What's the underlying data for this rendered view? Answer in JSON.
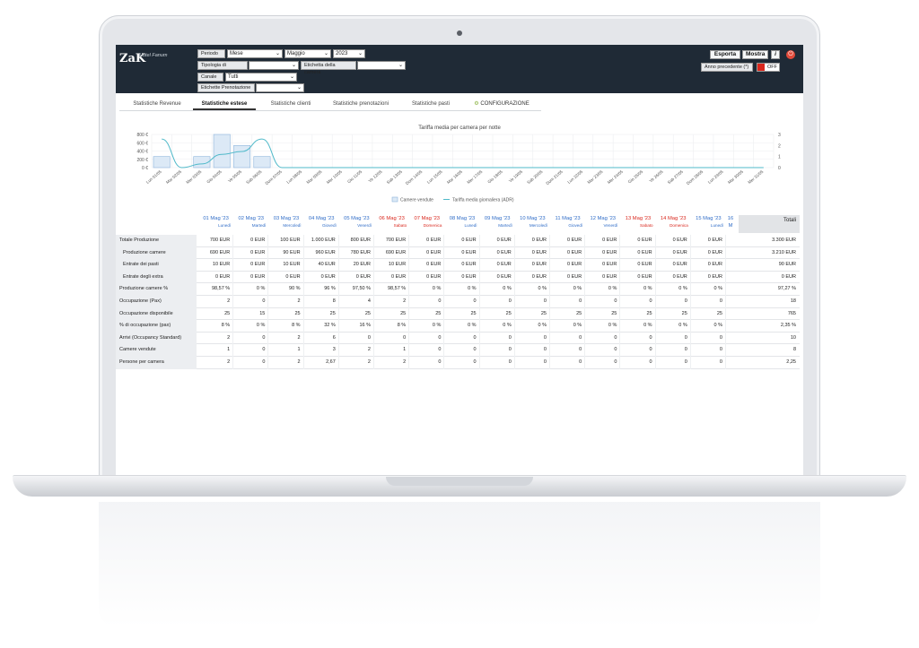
{
  "app": {
    "logo": "ZaK",
    "hotel": "Hotel Fanum"
  },
  "filters": {
    "periodo_label": "Periodo",
    "periodo_value": "Mese",
    "mese_value": "Maggio",
    "anno_value": "2023",
    "tipologia_label": "Tipologia di Camera",
    "tipologia_value": "",
    "etichetta_camera_label": "Etichetta della camera",
    "etichetta_camera_value": "",
    "canale_label": "Canale",
    "canale_value": "Tutti",
    "etichette_pren_label": "Etichette Prenotazione",
    "etichette_pren_value": ""
  },
  "actions": {
    "esporta": "Esporta",
    "mostra": "Mostra",
    "info": "i",
    "anno_precedente": "Anno precedente (*)",
    "toggle": "OFF"
  },
  "tabs": [
    {
      "label": "Statistiche Revenue"
    },
    {
      "label": "Statistiche estese"
    },
    {
      "label": "Statistiche clienti"
    },
    {
      "label": "Statistiche prenotazioni"
    },
    {
      "label": "Statistiche pasti"
    },
    {
      "label": "CONFIGURAZIONE"
    }
  ],
  "chart_data": {
    "type": "bar",
    "title": "Tariffa media per camera per notte",
    "categories": [
      "Lun 01/05",
      "Mar 02/05",
      "Mer 03/05",
      "Gio 04/05",
      "Ve 05/05",
      "Sab 06/05",
      "Dom 07/05",
      "Lun 08/05",
      "Mar 09/05",
      "Mer 10/05",
      "Gio 11/05",
      "Ve 12/05",
      "Sab 13/05",
      "Dom 14/05",
      "Lun 15/05",
      "Mar 16/05",
      "Mer 17/05",
      "Gio 18/05",
      "Ve 19/05",
      "Sab 20/05",
      "Dom 21/05",
      "Lun 22/05",
      "Mar 23/05",
      "Mer 24/05",
      "Gio 25/05",
      "Ve 26/05",
      "Sab 27/05",
      "Dom 28/05",
      "Lun 29/05",
      "Mar 30/05",
      "Mer 31/05"
    ],
    "series": [
      {
        "name": "Camere vendute",
        "type": "bar",
        "axis": "right",
        "values": [
          1,
          0,
          1,
          3,
          2,
          1,
          0,
          0,
          0,
          0,
          0,
          0,
          0,
          0,
          0,
          0,
          0,
          0,
          0,
          0,
          0,
          0,
          0,
          0,
          0,
          0,
          0,
          0,
          0,
          0,
          0
        ]
      },
      {
        "name": "Tariffa media giornaliera (ADR)",
        "type": "line",
        "axis": "left",
        "values": [
          690,
          0,
          90,
          320,
          390,
          690,
          0,
          0,
          0,
          0,
          0,
          0,
          0,
          0,
          0,
          0,
          0,
          0,
          0,
          0,
          0,
          0,
          0,
          0,
          0,
          0,
          0,
          0,
          0,
          0,
          0
        ]
      }
    ],
    "y_left": {
      "ticks": [
        "0 €",
        "200 €",
        "400 €",
        "600 €",
        "800 €"
      ],
      "ylim": [
        0,
        800
      ]
    },
    "y_right": {
      "ticks": [
        "0",
        "1",
        "2",
        "3"
      ],
      "ylim": [
        0,
        3
      ]
    },
    "legend": "bottom",
    "grid": true
  },
  "table": {
    "totals_label": "Totali",
    "days": [
      {
        "date": "01 Mag '23",
        "weekday": "Lunedì",
        "red": false
      },
      {
        "date": "02 Mag '23",
        "weekday": "Martedì",
        "red": false
      },
      {
        "date": "03 Mag '23",
        "weekday": "Mercoledì",
        "red": false
      },
      {
        "date": "04 Mag '23",
        "weekday": "Giovedì",
        "red": false
      },
      {
        "date": "05 Mag '23",
        "weekday": "Venerdì",
        "red": false
      },
      {
        "date": "06 Mag '23",
        "weekday": "Sabato",
        "red": true
      },
      {
        "date": "07 Mag '23",
        "weekday": "Domenica",
        "red": true
      },
      {
        "date": "08 Mag '23",
        "weekday": "Lunedì",
        "red": false
      },
      {
        "date": "09 Mag '23",
        "weekday": "Martedì",
        "red": false
      },
      {
        "date": "10 Mag '23",
        "weekday": "Mercoledì",
        "red": false
      },
      {
        "date": "11 Mag '23",
        "weekday": "Giovedì",
        "red": false
      },
      {
        "date": "12 Mag '23",
        "weekday": "Venerdì",
        "red": false
      },
      {
        "date": "13 Mag '23",
        "weekday": "Sabato",
        "red": true
      },
      {
        "date": "14 Mag '23",
        "weekday": "Domenica",
        "red": true
      },
      {
        "date": "15 Mag '23",
        "weekday": "Lunedì",
        "red": false
      },
      {
        "date": "16 M",
        "weekday": "",
        "red": false
      }
    ],
    "rows": [
      {
        "label": "Totale Produzione",
        "sub": false,
        "values": [
          "700 EUR",
          "0 EUR",
          "100 EUR",
          "1.000 EUR",
          "800 EUR",
          "700 EUR",
          "0 EUR",
          "0 EUR",
          "0 EUR",
          "0 EUR",
          "0 EUR",
          "0 EUR",
          "0 EUR",
          "0 EUR",
          "0 EUR"
        ],
        "total": "3.300 EUR"
      },
      {
        "label": "Produzione camere",
        "sub": true,
        "values": [
          "690 EUR",
          "0 EUR",
          "90 EUR",
          "960 EUR",
          "780 EUR",
          "690 EUR",
          "0 EUR",
          "0 EUR",
          "0 EUR",
          "0 EUR",
          "0 EUR",
          "0 EUR",
          "0 EUR",
          "0 EUR",
          "0 EUR"
        ],
        "total": "3.210 EUR"
      },
      {
        "label": "Entrate dei pasti",
        "sub": true,
        "values": [
          "10 EUR",
          "0 EUR",
          "10 EUR",
          "40 EUR",
          "20 EUR",
          "10 EUR",
          "0 EUR",
          "0 EUR",
          "0 EUR",
          "0 EUR",
          "0 EUR",
          "0 EUR",
          "0 EUR",
          "0 EUR",
          "0 EUR"
        ],
        "total": "90 EUR"
      },
      {
        "label": "Entrate degli extra",
        "sub": true,
        "values": [
          "0 EUR",
          "0 EUR",
          "0 EUR",
          "0 EUR",
          "0 EUR",
          "0 EUR",
          "0 EUR",
          "0 EUR",
          "0 EUR",
          "0 EUR",
          "0 EUR",
          "0 EUR",
          "0 EUR",
          "0 EUR",
          "0 EUR"
        ],
        "total": "0 EUR"
      },
      {
        "label": "Produzione camere %",
        "sub": false,
        "values": [
          "98,57 %",
          "0 %",
          "90 %",
          "96 %",
          "97,50 %",
          "98,57 %",
          "0 %",
          "0 %",
          "0 %",
          "0 %",
          "0 %",
          "0 %",
          "0 %",
          "0 %",
          "0 %"
        ],
        "total": "97,27 %"
      },
      {
        "label": "Occupazione (Pax)",
        "sub": false,
        "values": [
          "2",
          "0",
          "2",
          "8",
          "4",
          "2",
          "0",
          "0",
          "0",
          "0",
          "0",
          "0",
          "0",
          "0",
          "0"
        ],
        "total": "18"
      },
      {
        "label": "Occupazione disponibile",
        "sub": false,
        "values": [
          "25",
          "15",
          "25",
          "25",
          "25",
          "25",
          "25",
          "25",
          "25",
          "25",
          "25",
          "25",
          "25",
          "25",
          "25"
        ],
        "total": "765"
      },
      {
        "label": "% di occupazione (pax)",
        "sub": false,
        "values": [
          "8 %",
          "0 %",
          "8 %",
          "32 %",
          "16 %",
          "8 %",
          "0 %",
          "0 %",
          "0 %",
          "0 %",
          "0 %",
          "0 %",
          "0 %",
          "0 %",
          "0 %"
        ],
        "total": "2,35 %"
      },
      {
        "label": "Arrivi (Occupancy Standard)",
        "sub": false,
        "values": [
          "2",
          "0",
          "2",
          "6",
          "0",
          "0",
          "0",
          "0",
          "0",
          "0",
          "0",
          "0",
          "0",
          "0",
          "0"
        ],
        "total": "10"
      },
      {
        "label": "Camere vendute",
        "sub": false,
        "values": [
          "1",
          "0",
          "1",
          "3",
          "2",
          "1",
          "0",
          "0",
          "0",
          "0",
          "0",
          "0",
          "0",
          "0",
          "0"
        ],
        "total": "8"
      },
      {
        "label": "Persone per camera",
        "sub": false,
        "values": [
          "2",
          "0",
          "2",
          "2,67",
          "2",
          "2",
          "0",
          "0",
          "0",
          "0",
          "0",
          "0",
          "0",
          "0",
          "0"
        ],
        "total": "2,25"
      }
    ]
  },
  "colors": {
    "header_bg": "#1f2a36",
    "bar_fill": "#dce9f6",
    "bar_stroke": "#8db4dc",
    "line": "#4fb9c9",
    "weekend": "#d9261c",
    "weekday": "#2f6cc7"
  }
}
